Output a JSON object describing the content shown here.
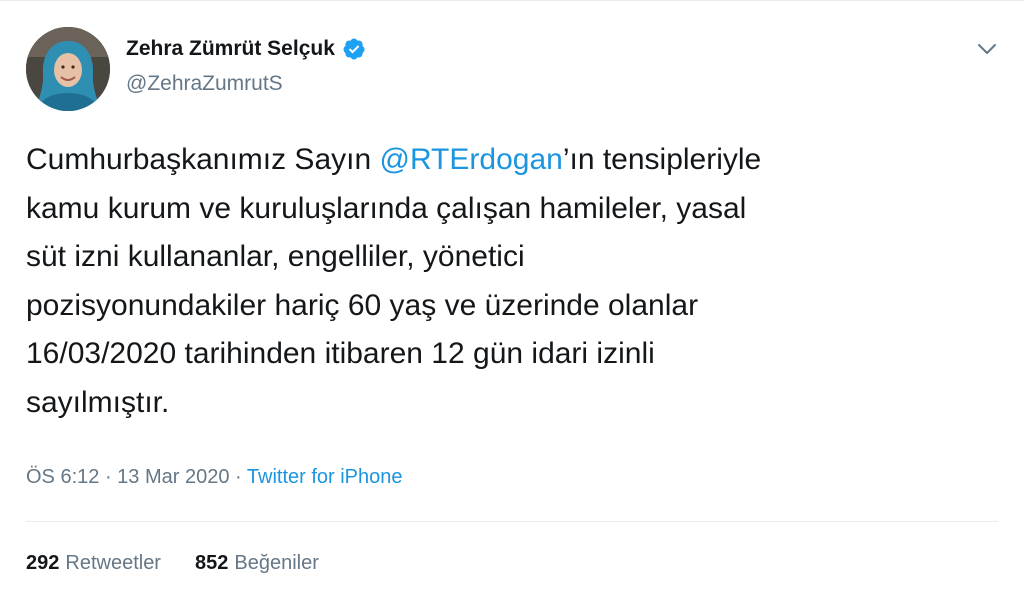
{
  "author": {
    "display_name": "Zehra Zümrüt Selçuk",
    "handle": "@ZehraZumrutS",
    "verified": true,
    "avatar_icon": "profile-photo"
  },
  "tweet": {
    "lines": [
      [
        "Cumhurbaşkanımız Sayın ",
        "@RTErdogan",
        "’ın tensipleriyle"
      ],
      "kamu kurum ve kuruluşlarında çalışan hamileler, yasal",
      "süt izni kullananlar, engelliler, yönetici",
      "pozisyonundakiler hariç 60 yaş ve üzerinde olanlar",
      "16/03/2020 tarihinden itibaren 12 gün idari izinli",
      "sayılmıştır."
    ]
  },
  "meta": {
    "time": "ÖS 6:12",
    "separator": " · ",
    "date": "13 Mar 2020",
    "source": "Twitter for iPhone"
  },
  "stats": {
    "retweets_count": "292",
    "retweets_label": "Retweetler",
    "likes_count": "852",
    "likes_label": "Beğeniler"
  },
  "colors": {
    "link": "#1b95e0",
    "secondary_text": "#657786",
    "primary_text": "#14171a",
    "verified_badge": "#1da1f2",
    "divider": "#e6ecf0"
  },
  "icons": {
    "verified": "verified-badge-icon",
    "menu": "chevron-down-icon"
  }
}
